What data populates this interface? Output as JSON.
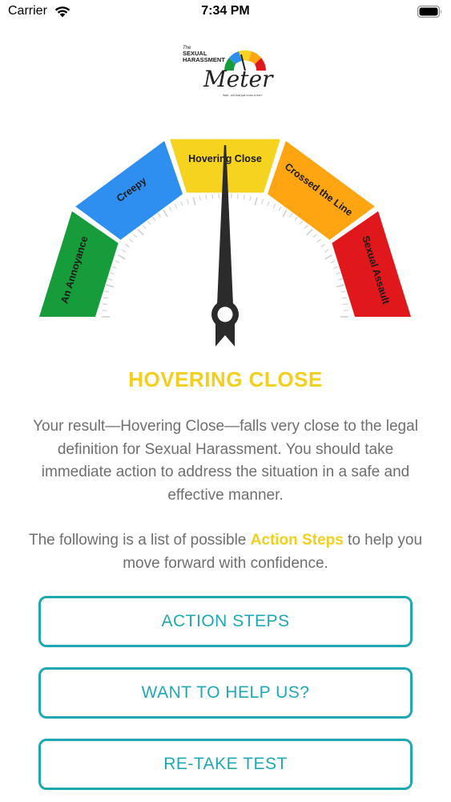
{
  "status_bar": {
    "carrier": "Carrier",
    "time": "7:34 PM",
    "icons": [
      "wifi-icon",
      "battery-icon"
    ]
  },
  "logo": {
    "line1": "The",
    "line2": "SEXUAL",
    "line3": "HARASSMENT",
    "word": "Meter",
    "tagline": "Wait...did that just cross a line?"
  },
  "gauge": {
    "segments": [
      {
        "label": "An Annoyance",
        "color": "#169c3a"
      },
      {
        "label": "Creepy",
        "color": "#2e8ff0"
      },
      {
        "label": "Hovering Close",
        "color": "#f6d31f"
      },
      {
        "label": "Crossed the Line",
        "color": "#ffa511"
      },
      {
        "label": "Sexual Assault",
        "color": "#e0171b"
      }
    ],
    "needle_value": "Hovering Close"
  },
  "result": {
    "title": "HOVERING CLOSE",
    "body": "Your result—Hovering Close—falls very close to the legal definition for Sexual Harassment. You should take immediate action to address the situation in a safe and effective manner.",
    "follow_prefix": "The following is a list of possible ",
    "follow_highlight": "Action Steps",
    "follow_suffix": " to help you move forward with confidence."
  },
  "buttons": {
    "action_steps": "ACTION STEPS",
    "want_to_help": "WANT TO HELP US?",
    "retake": "RE-TAKE TEST"
  },
  "colors": {
    "accent_yellow": "#f3cf1d",
    "button_teal": "#1ea8b4",
    "body_text": "#6f6f6f"
  }
}
